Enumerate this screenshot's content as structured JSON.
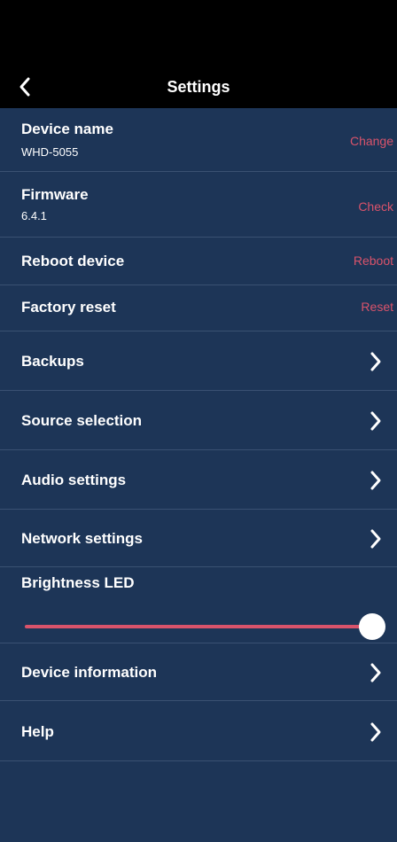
{
  "nav": {
    "title": "Settings",
    "back_icon": "chevron-left-icon"
  },
  "device_name": {
    "title": "Device name",
    "value": "WHD-5055",
    "action": "Change"
  },
  "firmware": {
    "title": "Firmware",
    "value": "6.4.1",
    "action": "Check"
  },
  "reboot": {
    "title": "Reboot device",
    "action": "Reboot"
  },
  "factory_reset": {
    "title": "Factory reset",
    "action": "Reset"
  },
  "menu": {
    "backups": "Backups",
    "source_selection": "Source selection",
    "audio_settings": "Audio settings",
    "network_settings": "Network settings",
    "device_information": "Device information",
    "help": "Help"
  },
  "brightness": {
    "title": "Brightness LED",
    "level": 1.0
  },
  "colors": {
    "background": "#1d3557",
    "accent": "#d9536b",
    "bar": "#000000",
    "text": "#ffffff",
    "divider": "#3a5172"
  }
}
